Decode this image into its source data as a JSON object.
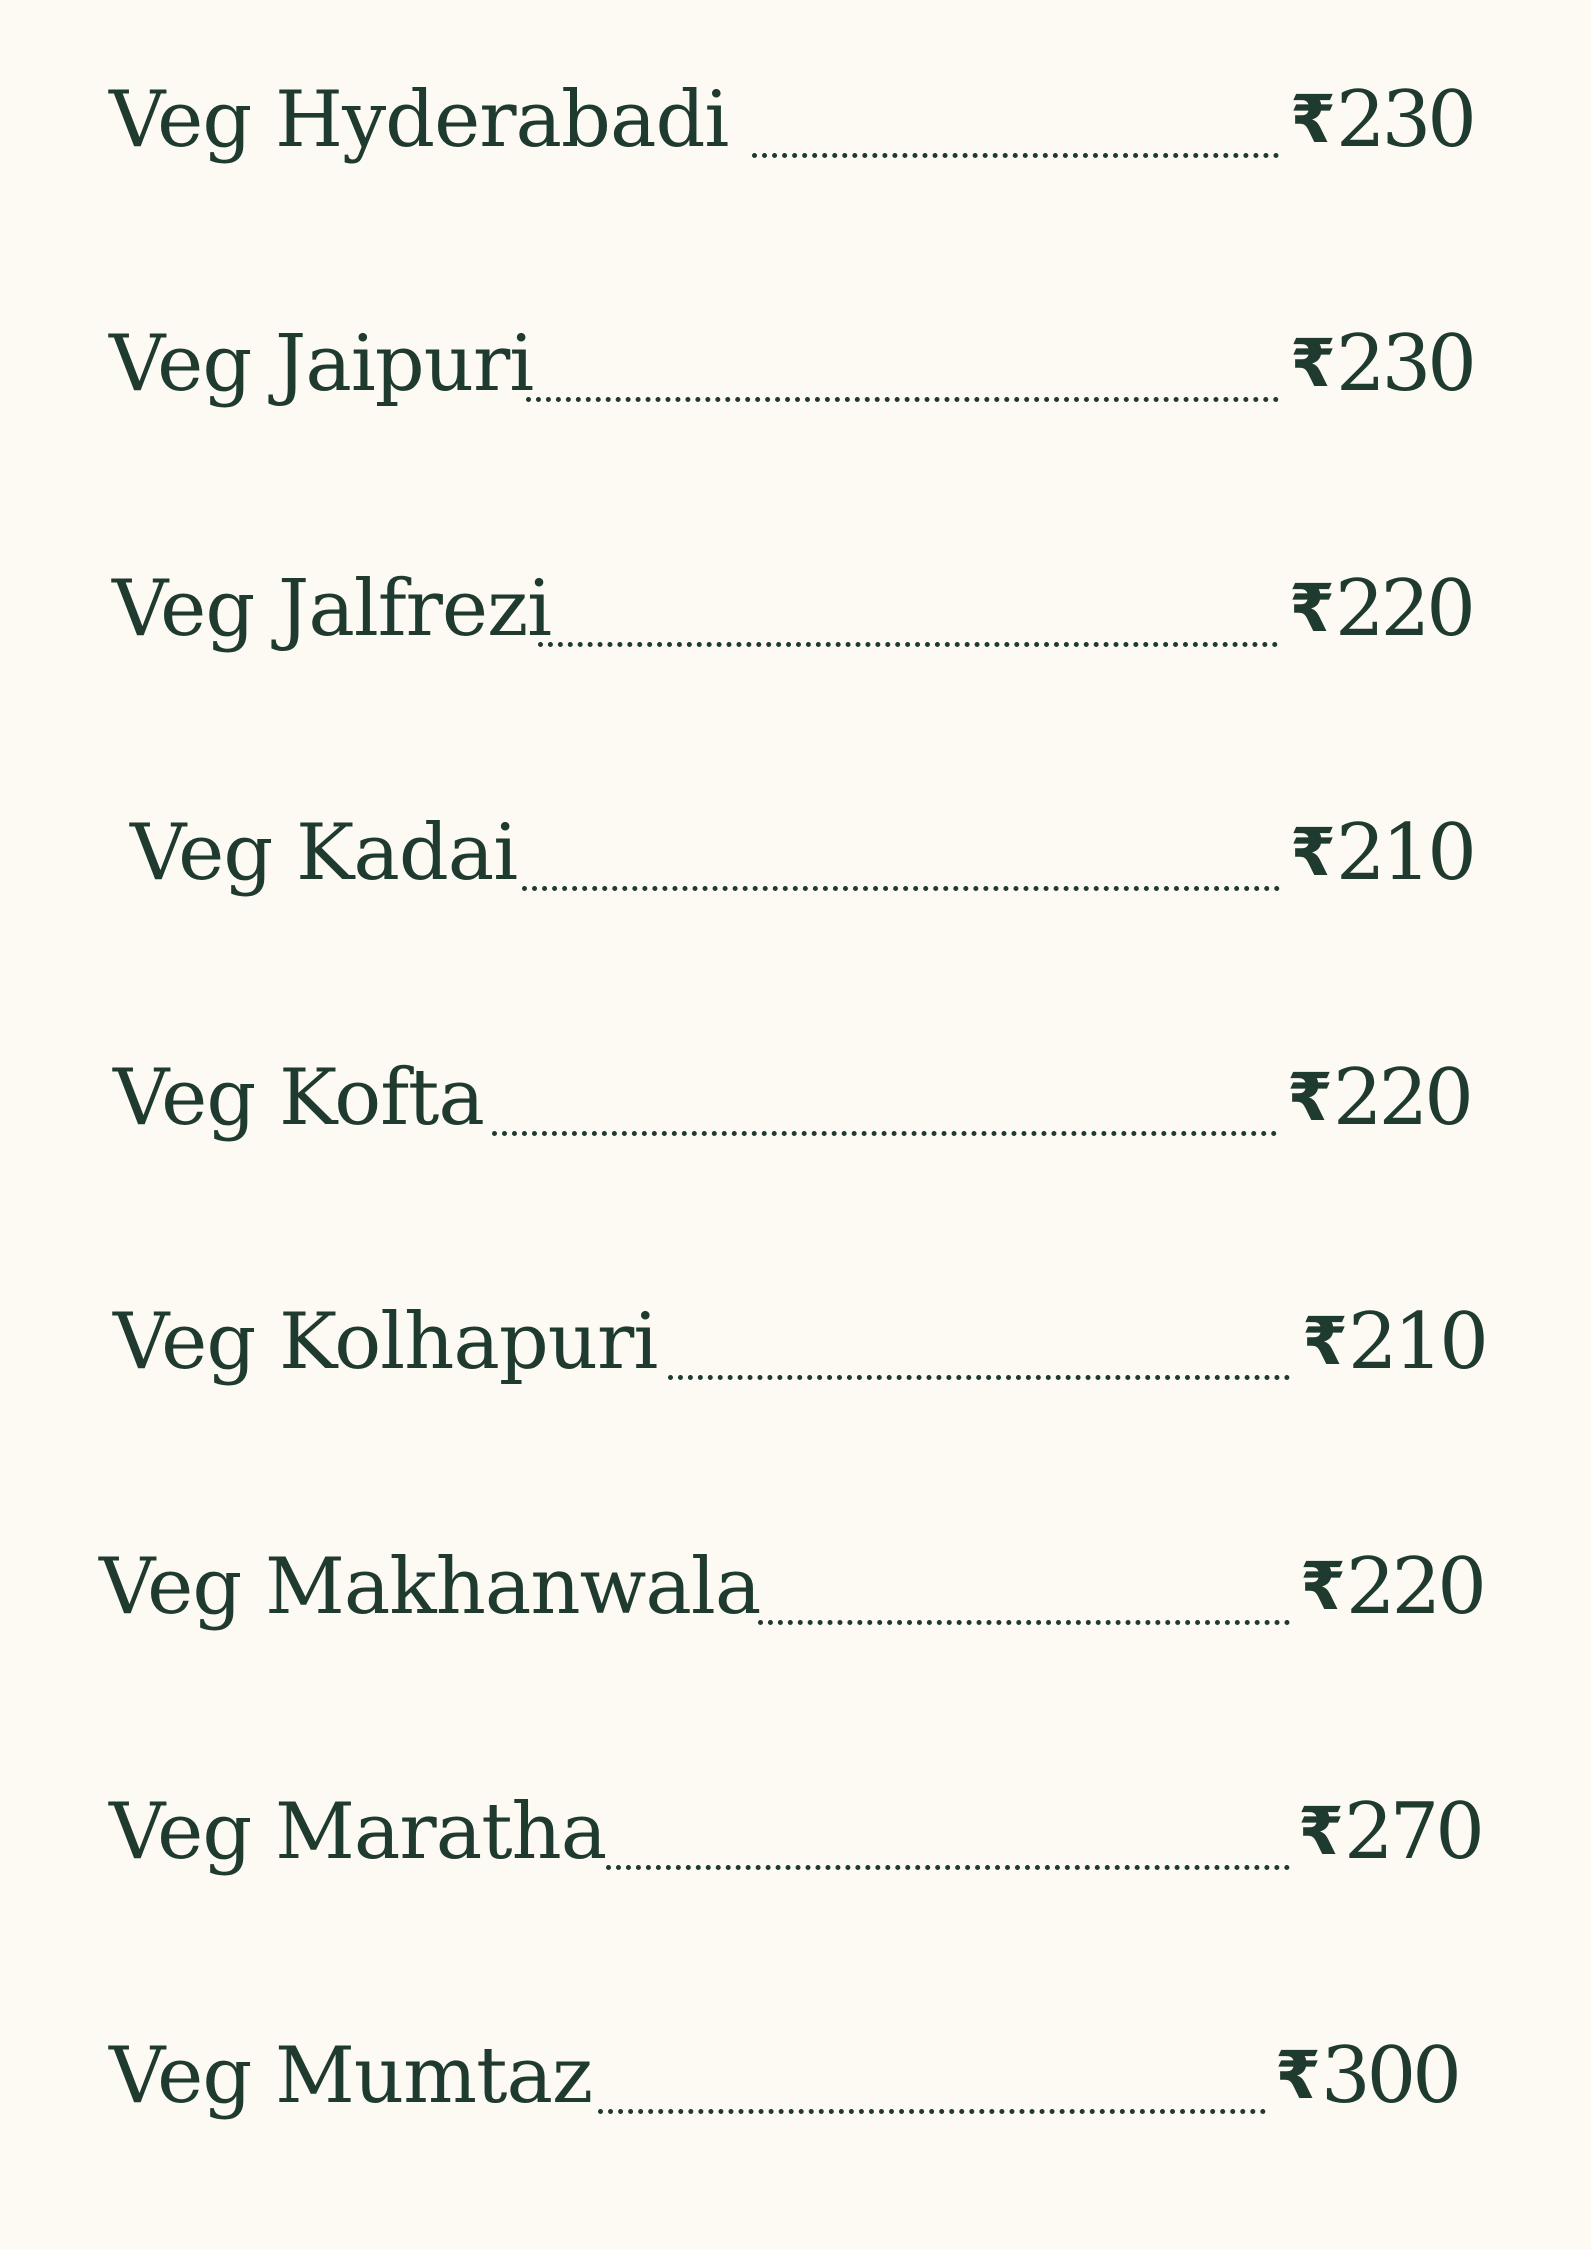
{
  "menu": {
    "currency_symbol": "₹",
    "items": [
      {
        "name": "Veg Hyderabadi",
        "price": "230"
      },
      {
        "name": "Veg Jaipuri",
        "price": "230"
      },
      {
        "name": "Veg Jalfrezi",
        "price": "220"
      },
      {
        "name": "Veg Kadai",
        "price": "210"
      },
      {
        "name": "Veg Kofta",
        "price": "220"
      },
      {
        "name": "Veg Kolhapuri",
        "price": "210"
      },
      {
        "name": "Veg Makhanwala",
        "price": "220"
      },
      {
        "name": "Veg Maratha",
        "price": "270"
      },
      {
        "name": "Veg Mumtaz",
        "price": "300"
      }
    ]
  },
  "colors": {
    "background": "#fdfaf4",
    "text": "#1f3a2e"
  }
}
